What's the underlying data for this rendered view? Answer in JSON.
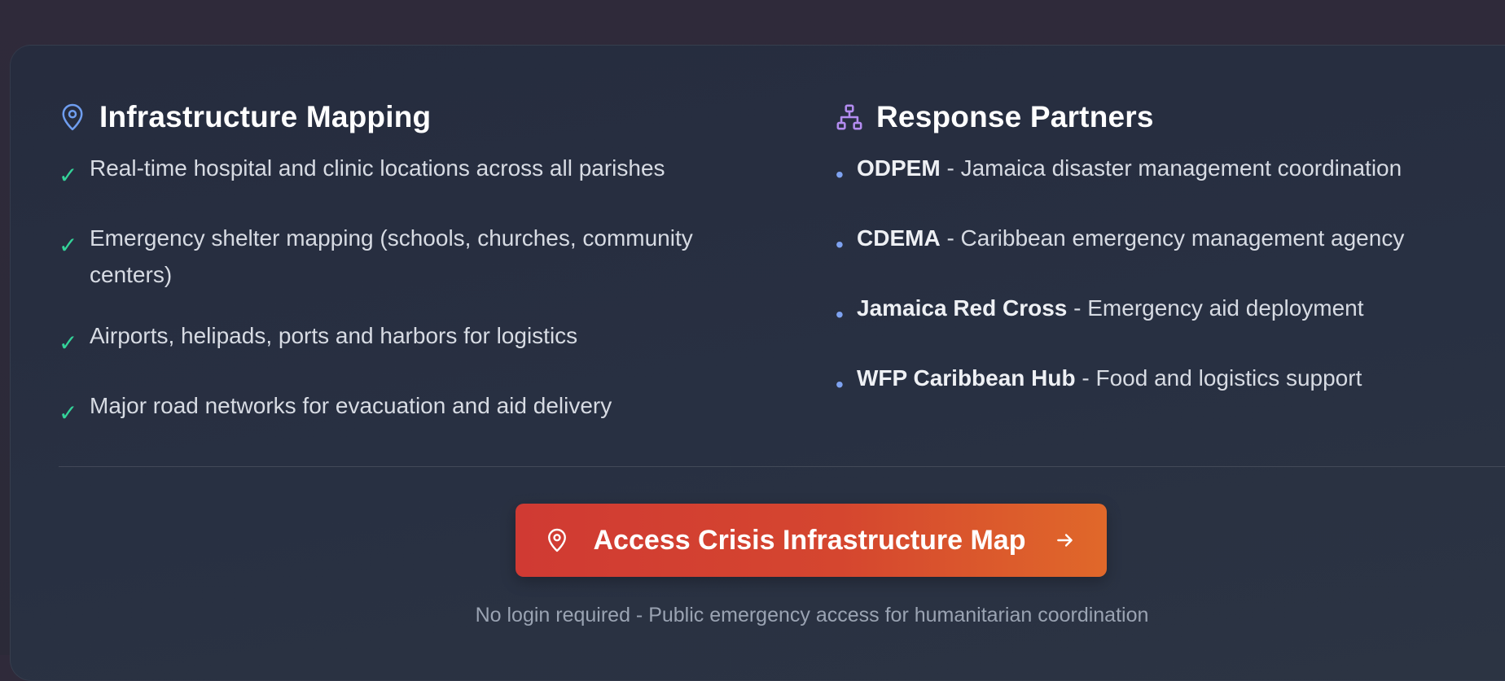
{
  "infrastructure": {
    "title": "Infrastructure Mapping",
    "icon": "map-pin-icon",
    "items": [
      "Real-time hospital and clinic locations across all parishes",
      "Emergency shelter mapping (schools, churches, community centers)",
      "Airports, helipads, ports and harbors for logistics",
      "Major road networks for evacuation and aid delivery"
    ],
    "check_glyph": "✓"
  },
  "partners": {
    "title": "Response Partners",
    "icon": "network-icon",
    "bullet_glyph": "•",
    "items": [
      {
        "name": "ODPEM",
        "desc": " - Jamaica disaster management coordination"
      },
      {
        "name": "CDEMA",
        "desc": " - Caribbean emergency management agency"
      },
      {
        "name": "Jamaica Red Cross",
        "desc": " - Emergency aid deployment"
      },
      {
        "name": "WFP Caribbean Hub",
        "desc": " - Food and logistics support"
      }
    ]
  },
  "cta": {
    "label": "Access Crisis Infrastructure Map",
    "icon": "map-pin-icon",
    "arrow_icon": "arrow-right-icon"
  },
  "note": "No login required - Public emergency access for humanitarian coordination",
  "colors": {
    "accent_check": "#34d399",
    "bullet": "#7ea2f0",
    "pin_icon": "#6f9ef0",
    "network_icon": "#b38cf0",
    "cta_start": "#d03a33",
    "cta_end": "#e0682a"
  }
}
